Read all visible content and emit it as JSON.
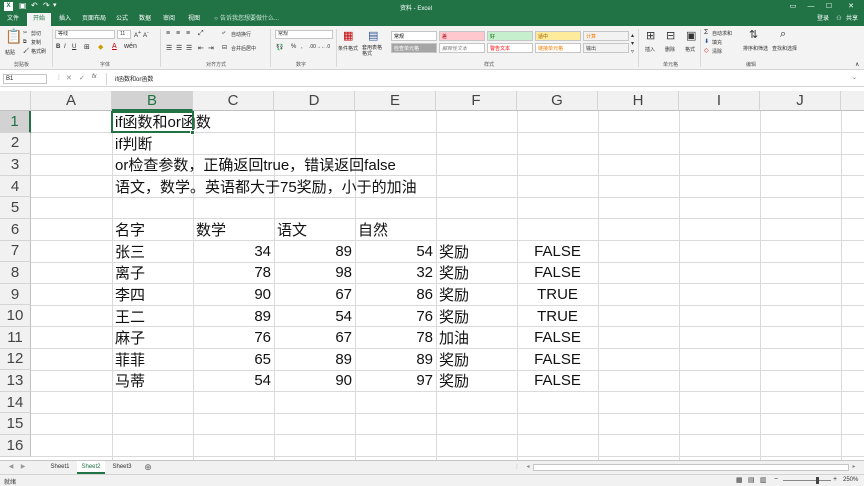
{
  "window": {
    "title": "资料 - Excel",
    "user": "登录",
    "share": "共享"
  },
  "tabs": [
    "文件",
    "开始",
    "插入",
    "页面布局",
    "公式",
    "数据",
    "审阅",
    "视图"
  ],
  "tell_me": "告诉我您想要做什么...",
  "ribbon": {
    "clipboard": {
      "paste": "粘贴",
      "cut": "剪切",
      "copy": "复制",
      "format_painter": "格式刷",
      "label": "剪贴板"
    },
    "font": {
      "name": "等线",
      "size": "11",
      "bold": "B",
      "italic": "I",
      "underline": "U",
      "label": "字体"
    },
    "alignment": {
      "wrap": "自动换行",
      "merge": "合并后居中",
      "label": "对齐方式"
    },
    "number": {
      "format": "常规",
      "label": "数字"
    },
    "styles": {
      "conditional": "条件格式",
      "as_table": "套用表格格式",
      "label": "样式",
      "cells": [
        {
          "text": "常规",
          "bg": "#ffffff",
          "fg": "#000000"
        },
        {
          "text": "差",
          "bg": "#ffc7ce",
          "fg": "#9c0006"
        },
        {
          "text": "好",
          "bg": "#c6efce",
          "fg": "#006100"
        },
        {
          "text": "适中",
          "bg": "#ffeb9c",
          "fg": "#9c5700"
        },
        {
          "text": "计算",
          "bg": "#f2f2f2",
          "fg": "#fa7d00"
        },
        {
          "text": "检查单元格",
          "bg": "#a5a5a5",
          "fg": "#ffffff"
        },
        {
          "text": "解释性文本",
          "bg": "#ffffff",
          "fg": "#7f7f7f"
        },
        {
          "text": "警告文本",
          "bg": "#ffffff",
          "fg": "#ff0000"
        },
        {
          "text": "链接单元格",
          "bg": "#ffffff",
          "fg": "#fa7d00"
        },
        {
          "text": "输出",
          "bg": "#f2f2f2",
          "fg": "#3f3f3f"
        }
      ]
    },
    "cells_group": {
      "insert": "插入",
      "delete": "删除",
      "format": "格式",
      "label": "单元格"
    },
    "editing": {
      "autosum": "自动求和",
      "fill": "填充",
      "clear": "清除",
      "sort": "排序和筛选",
      "find": "查找和选择",
      "label": "编辑"
    }
  },
  "formula_bar": {
    "name_box": "B1",
    "fx": "fx",
    "content": "if函数和or函数"
  },
  "columns": [
    "A",
    "B",
    "C",
    "D",
    "E",
    "F",
    "G",
    "H",
    "I",
    "J"
  ],
  "rows": [
    "1",
    "2",
    "3",
    "4",
    "5",
    "6",
    "7",
    "8",
    "9",
    "10",
    "11",
    "12",
    "13",
    "14",
    "15",
    "16"
  ],
  "text_lines": {
    "r1": "if函数和or函数",
    "r2": "if判断",
    "r3": "or检查参数，正确返回true，错误返回false",
    "r4": "语文，数学。英语都大于75奖励，小于的加油"
  },
  "table": {
    "headers": [
      "名字",
      "数学",
      "语文",
      "自然"
    ],
    "rows": [
      {
        "name": "张三",
        "math": "34",
        "chinese": "89",
        "nature": "54",
        "result": "奖励",
        "check": "FALSE"
      },
      {
        "name": "离子",
        "math": "78",
        "chinese": "98",
        "nature": "32",
        "result": "奖励",
        "check": "FALSE"
      },
      {
        "name": "李四",
        "math": "90",
        "chinese": "67",
        "nature": "86",
        "result": "奖励",
        "check": "TRUE"
      },
      {
        "name": "王二",
        "math": "89",
        "chinese": "54",
        "nature": "76",
        "result": "奖励",
        "check": "TRUE"
      },
      {
        "name": "麻子",
        "math": "76",
        "chinese": "67",
        "nature": "78",
        "result": "加油",
        "check": "FALSE"
      },
      {
        "name": "菲菲",
        "math": "65",
        "chinese": "89",
        "nature": "89",
        "result": "奖励",
        "check": "FALSE"
      },
      {
        "name": "马蒂",
        "math": "54",
        "chinese": "90",
        "nature": "97",
        "result": "奖励",
        "check": "FALSE"
      }
    ]
  },
  "sheets": [
    "Sheet1",
    "Sheet2",
    "Sheet3"
  ],
  "active_sheet": "Sheet2",
  "status": {
    "mode": "就绪",
    "zoom": "250%"
  },
  "colors": {
    "accent": "#217346",
    "ribbon_bg": "#f3f3f3"
  }
}
